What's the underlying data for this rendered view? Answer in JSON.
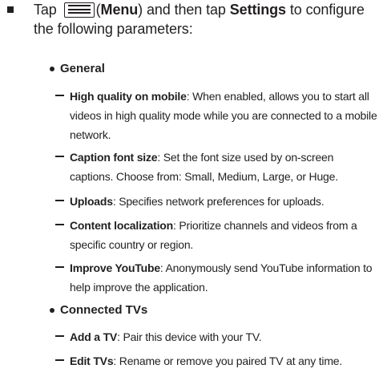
{
  "intro": {
    "tap_word": "Tap",
    "menu_label": "Menu",
    "then_tap": "and then tap",
    "settings_label": "Settings",
    "rest": "to configure the following parameters:",
    "menu_icon": "menu-icon"
  },
  "general": {
    "title": "General",
    "items": [
      {
        "term": "High quality on mobile",
        "desc": ": When enabled, allows you to start all videos in high quality mode while you are connected to a mobile network."
      },
      {
        "term": "Caption font size",
        "desc": ": Set the font size used by on-screen captions. Choose from: Small, Medium, Large, or Huge."
      },
      {
        "term": "Uploads",
        "desc": ": Specifies network preferences for uploads."
      },
      {
        "term": "Content localization",
        "desc": ": Prioritize channels and videos from a specific country or region."
      },
      {
        "term": "Improve YouTube",
        "desc": ": Anonymously send YouTube information to help improve the application."
      }
    ]
  },
  "connected_tvs": {
    "title": "Connected TVs",
    "items": [
      {
        "term": "Add a TV",
        "desc": ": Pair this device with your TV."
      },
      {
        "term": "Edit TVs",
        "desc": ": Rename or remove you paired TV at any time."
      }
    ]
  }
}
